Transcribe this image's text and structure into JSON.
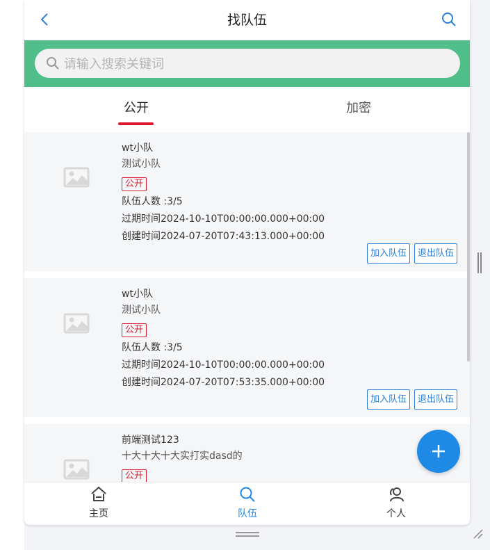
{
  "header": {
    "title": "找队伍"
  },
  "search": {
    "placeholder": "请输入搜索关键词"
  },
  "tabs": [
    {
      "label": "公开"
    },
    {
      "label": "加密"
    }
  ],
  "teams": [
    {
      "name": "wt小队",
      "description": "测试小队",
      "status": "公开",
      "members": "队伍人数 :3/5",
      "expire": "过期时间2024-10-10T00:00:00.000+00:00",
      "created": "创建时间2024-07-20T07:43:13.000+00:00",
      "join_label": "加入队伍",
      "quit_label": "退出队伍"
    },
    {
      "name": "wt小队",
      "description": "测试小队",
      "status": "公开",
      "members": "队伍人数 :3/5",
      "expire": "过期时间2024-10-10T00:00:00.000+00:00",
      "created": "创建时间2024-07-20T07:53:35.000+00:00",
      "join_label": "加入队伍",
      "quit_label": "退出队伍"
    },
    {
      "name": "前端测试123",
      "description": "十大十大十大实打实dasd的",
      "status": "公开"
    }
  ],
  "fab": {
    "icon": "plus-icon"
  },
  "tabbar": [
    {
      "label": "主页",
      "icon": "home-icon"
    },
    {
      "label": "队伍",
      "icon": "search-icon"
    },
    {
      "label": "个人",
      "icon": "user-icon"
    }
  ],
  "colors": {
    "brand_green": "#4fbe88",
    "accent_blue": "#1e8ae6",
    "tab_red": "#e0182d",
    "badge_red": "#d81e2e"
  }
}
